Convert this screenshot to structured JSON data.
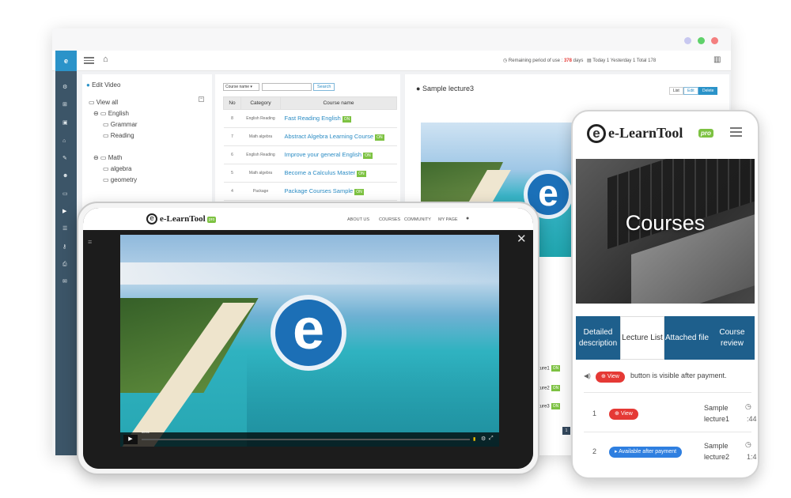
{
  "desktop": {
    "logo": "e",
    "remaining_label": "Remaining period of use :",
    "remaining_days": "378",
    "remaining_unit": "days",
    "visits": "Today 1  Yesterday 1  Total 178",
    "tree": {
      "title": "Edit Video",
      "view_all": "View all",
      "groups": [
        {
          "name": "English",
          "items": [
            "Grammar",
            "Reading"
          ]
        },
        {
          "name": "Math",
          "items": [
            "algebra",
            "geometry"
          ]
        }
      ]
    },
    "search": {
      "select": "Course name",
      "button": "Search"
    },
    "table": {
      "headers": [
        "No",
        "Category",
        "Course name"
      ],
      "rows": [
        {
          "no": "8",
          "cat": "English Reading",
          "name": "Fast Reading English"
        },
        {
          "no": "7",
          "cat": "Math algebra",
          "name": "Abstract Algebra Learning Course"
        },
        {
          "no": "6",
          "cat": "English Reading",
          "name": "Improve your general English"
        },
        {
          "no": "5",
          "cat": "Math algebra",
          "name": "Become a Calculus Master"
        },
        {
          "no": "4",
          "cat": "Package",
          "name": "Package Courses Sample"
        }
      ],
      "on_label": "ON"
    },
    "lecture": {
      "title": "Sample lecture3",
      "buttons": [
        "List",
        "Edit",
        "Delete"
      ],
      "partial_rows": [
        "cture1",
        "cture2",
        "cture3"
      ],
      "page": "1"
    }
  },
  "tablet": {
    "brand": "e-LearnTool",
    "brand_badge": "pro",
    "nav": [
      "ABOUT US",
      "COURSES",
      "COMMUNITY",
      "MY PAGE"
    ],
    "video_time": "00:01",
    "video_logo": "e"
  },
  "phone": {
    "brand": "e-LearnTool",
    "brand_badge": "pro",
    "hero": "Courses",
    "tabs": [
      {
        "label": "Detailed description",
        "active": false
      },
      {
        "label": "Lecture List",
        "active": true
      },
      {
        "label": "Attached file",
        "active": false
      },
      {
        "label": "Course review",
        "active": false
      }
    ],
    "notice_btn": "View",
    "notice": "button is visible after payment.",
    "lectures": [
      {
        "no": "1",
        "btn": "View",
        "name": "Sample lecture1",
        "time": ":44"
      },
      {
        "no": "2",
        "btn": "Available after payment",
        "name": "Sample lecture2",
        "time": "1:4"
      }
    ]
  },
  "colors": {
    "accent": "#2b93c9",
    "sidebar": "#3c5568",
    "on": "#7dc242",
    "phone_tab": "#1e5f8c",
    "view_red": "#e53935",
    "avail_blue": "#2f7fe0"
  }
}
